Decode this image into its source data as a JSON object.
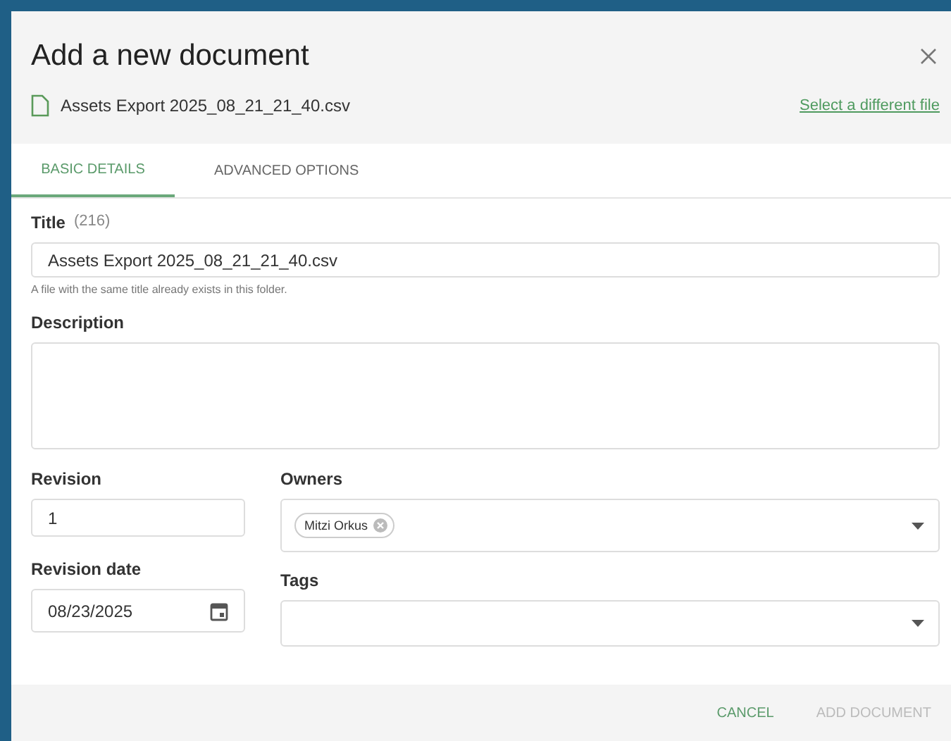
{
  "dialog": {
    "title": "Add a new document",
    "file_name": "Assets Export 2025_08_21_21_40.csv",
    "change_file_link": "Select a different file"
  },
  "tabs": [
    {
      "label": "BASIC DETAILS",
      "selected": true
    },
    {
      "label": "ADVANCED OPTIONS",
      "selected": false
    }
  ],
  "title_field": {
    "label": "Title",
    "count": "(216)",
    "value": "Assets Export 2025_08_21_21_40.csv",
    "hint": "A file with the same title already exists in this folder."
  },
  "description_field": {
    "label": "Description"
  },
  "revision_field": {
    "label": "Revision",
    "value": "1"
  },
  "revision_date_field": {
    "label": "Revision date",
    "value": "08/23/2025"
  },
  "owners_field": {
    "label": "Owners",
    "chips": [
      "Mitzi Orkus"
    ]
  },
  "tags_field": {
    "label": "Tags"
  },
  "buttons": [
    {
      "label": "CANCEL",
      "disabled": false
    },
    {
      "label": "ADD DOCUMENT",
      "disabled": true
    }
  ]
}
